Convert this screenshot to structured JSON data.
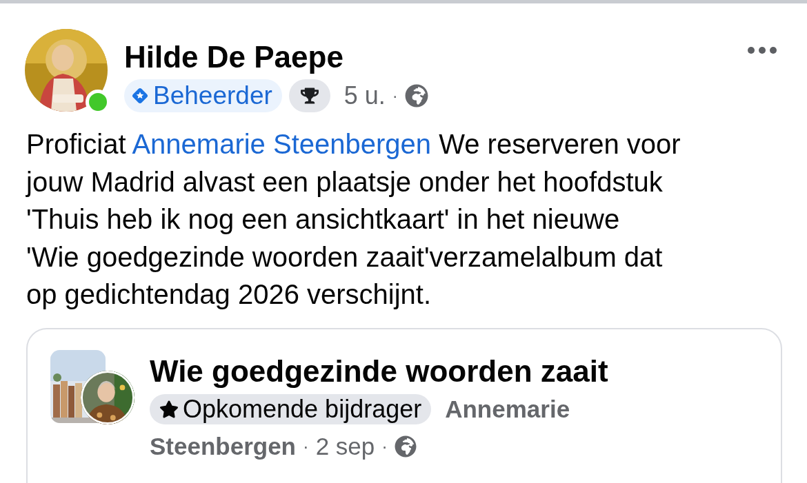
{
  "post": {
    "author": "Hilde De Paepe",
    "online": true,
    "role_badge": "Beheerder",
    "time": "5 u.",
    "separator": "·",
    "text": {
      "before": "Proficiat",
      "mention": "Annemarie Steenbergen",
      "after": "We reserveren voor",
      "lines": [
        "jouw Madrid alvast een plaatsje onder het hoofdstuk",
        "'Thuis heb ik nog een ansichtkaart' in het nieuwe",
        "'Wie goedgezinde woorden zaait'verzamelalbum dat",
        "op gedichtendag 2026 verschijnt."
      ]
    }
  },
  "shared_post": {
    "group": "Wie goedgezinde woorden zaait",
    "badge": "Opkomende bijdrager",
    "author_lines": [
      "Annemarie",
      "Steenbergen"
    ],
    "date": "2 sep",
    "separator": "·"
  }
}
